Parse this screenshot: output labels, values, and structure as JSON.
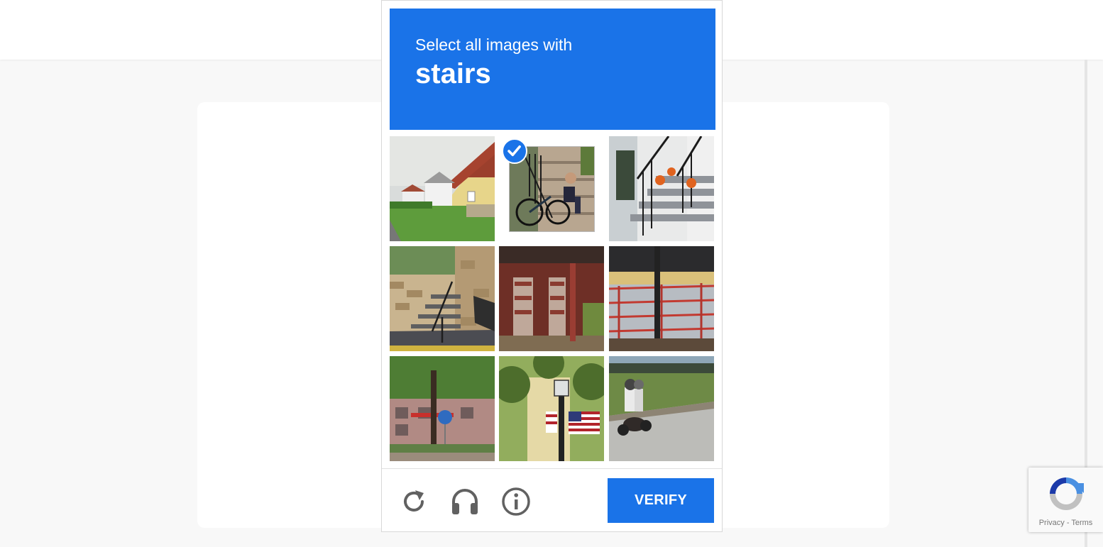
{
  "captcha": {
    "instruction_line1": "Select all images with",
    "instruction_target": "stairs",
    "accent_color": "#1a73e8",
    "selected_tiles": [
      2
    ],
    "tiles": [
      {
        "index": 1,
        "content": "house with red roof and path"
      },
      {
        "index": 2,
        "content": "man sitting on steps with bicycle"
      },
      {
        "index": 3,
        "content": "porch stairs with pumpkins"
      },
      {
        "index": 4,
        "content": "stone wall stairs with railing"
      },
      {
        "index": 5,
        "content": "red brick building"
      },
      {
        "index": 6,
        "content": "red railing walkway"
      },
      {
        "index": 7,
        "content": "tree and bike sign"
      },
      {
        "index": 8,
        "content": "flag on lamp post"
      },
      {
        "index": 9,
        "content": "motorcycle riders on road"
      }
    ],
    "controls": {
      "reload_icon": "reload-icon",
      "audio_icon": "headphones-icon",
      "info_icon": "info-icon",
      "verify_label": "VERIFY"
    }
  },
  "recaptcha_badge": {
    "privacy": "Privacy",
    "separator": " - ",
    "terms": "Terms"
  }
}
